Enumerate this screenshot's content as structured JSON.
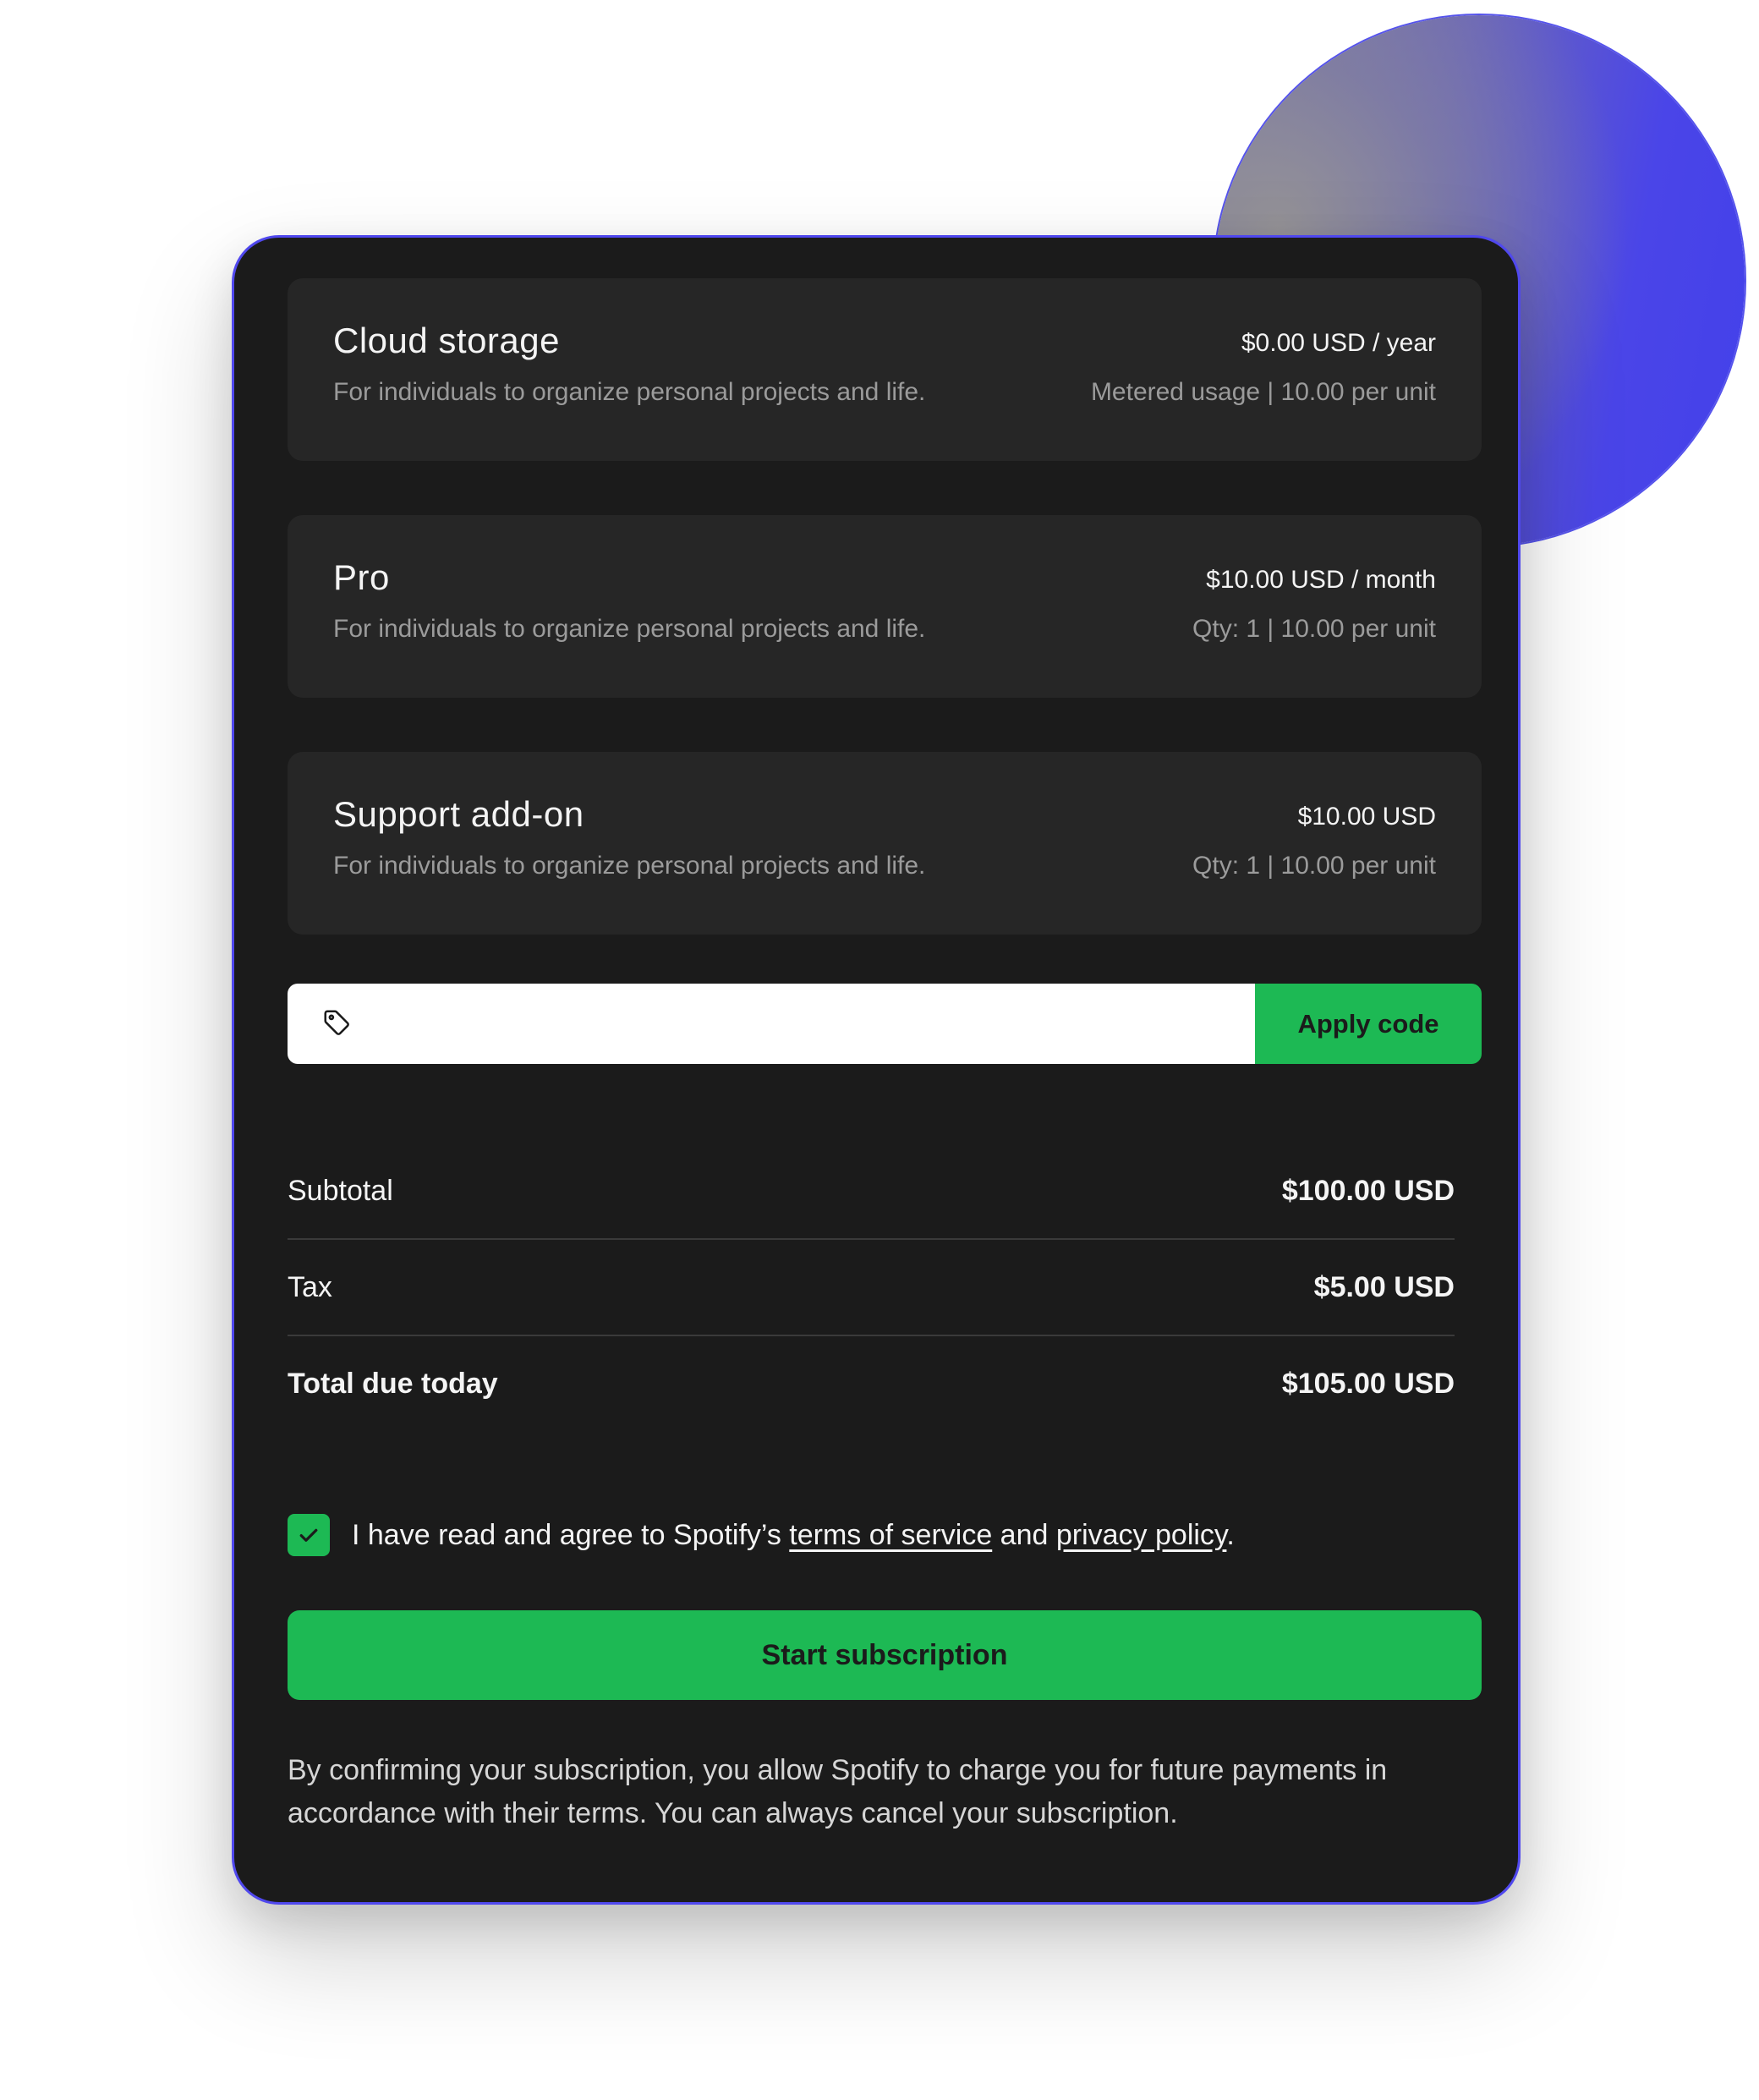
{
  "items": [
    {
      "name": "Cloud storage",
      "description": "For individuals to organize personal projects and life.",
      "price": "$0.00 USD / year",
      "meta": "Metered usage | 10.00 per unit"
    },
    {
      "name": "Pro",
      "description": "For individuals to organize personal projects and life.",
      "price": "$10.00 USD / month",
      "meta": "Qty: 1 | 10.00 per unit"
    },
    {
      "name": "Support add-on",
      "description": "For individuals to organize personal projects and life.",
      "price": "$10.00 USD",
      "meta": "Qty: 1 | 10.00 per unit"
    }
  ],
  "promo": {
    "value": "",
    "icon": "tag-icon",
    "apply_label": "Apply code"
  },
  "totals": {
    "subtotal_label": "Subtotal",
    "subtotal_value": "$100.00 USD",
    "tax_label": "Tax",
    "tax_value": "$5.00 USD",
    "total_label": "Total due today",
    "total_value": "$105.00 USD"
  },
  "agreement": {
    "checked": true,
    "text_before": "I have read and agree to Spotify’s ",
    "terms_link": "terms of service",
    "text_middle": " and ",
    "privacy_link": "privacy policy",
    "text_after": "."
  },
  "actions": {
    "start_label": "Start subscription"
  },
  "disclaimer": "By confirming your subscription, you allow Spotify to charge you for future payments in accordance with their terms. You can always cancel your subscription.",
  "colors": {
    "accent": "#1db954",
    "card_bg": "#1b1b1b",
    "item_bg": "#262626",
    "border": "#5048ee",
    "orb": "#4340ea"
  }
}
